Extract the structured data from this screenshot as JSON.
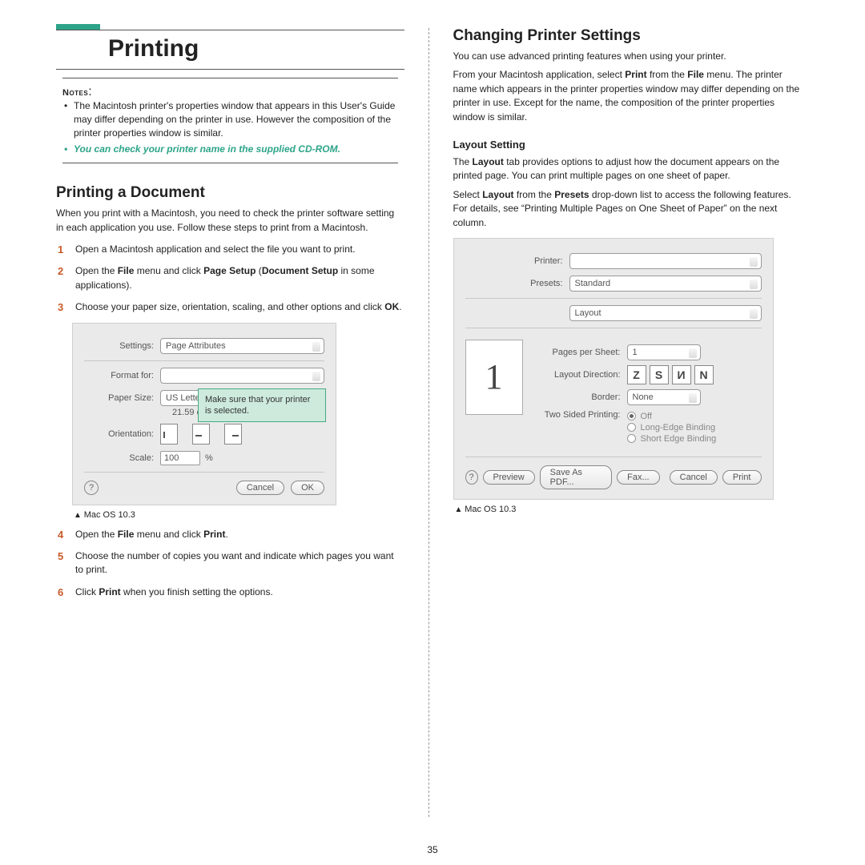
{
  "page_number": "35",
  "left": {
    "title": "Printing",
    "notes_label": "Notes",
    "note1": "The Macintosh printer's properties window that appears in this User's Guide may differ depending on the printer in use. However the composition of the printer properties window is similar.",
    "note2": "You can check your printer name in the supplied CD-ROM.",
    "sect": "Printing a Document",
    "p1": "When you print with a Macintosh, you need to check the printer software setting in each application you use. Follow these steps to print from a Macintosh.",
    "step1": "Open a Macintosh application and select the file you want to print.",
    "step2_pre": "Open the ",
    "step2_b1": "File",
    "step2_mid": " menu and click ",
    "step2_b2": "Page Setup",
    "step2_paren_open": " (",
    "step2_b3": "Document Setup",
    "step2_end": " in some applications).",
    "step3_pre": "Choose your paper size, orientation, scaling, and other options and click ",
    "step3_b": "OK",
    "step3_dot": ".",
    "shot_caption": "Mac OS 10.3",
    "step4_pre": "Open the ",
    "step4_b1": "File",
    "step4_mid": " menu and click ",
    "step4_b2": "Print",
    "step4_dot": ".",
    "step5": "Choose the number of copies you want and indicate which pages you want to print.",
    "step6_pre": "Click ",
    "step6_b": "Print",
    "step6_post": " when you finish setting the options.",
    "shot1": {
      "settings_label": "Settings:",
      "settings_value": "Page Attributes",
      "format_label": "Format for:",
      "paper_label": "Paper Size:",
      "paper_value": "US Letter",
      "paper_dim": "21.59 cm",
      "orientation_label": "Orientation:",
      "scale_label": "Scale:",
      "scale_value": "100",
      "percent": "%",
      "cancel": "Cancel",
      "ok": "OK",
      "help": "?",
      "tooltip": "Make sure that your printer is selected."
    }
  },
  "right": {
    "sect": "Changing Printer Settings",
    "p1": "You can use advanced printing features when using your printer.",
    "p2_pre": "From your Macintosh application, select ",
    "p2_b1": "Print",
    "p2_mid": " from the ",
    "p2_b2": "File",
    "p2_post": " menu. The printer name which appears in the printer properties window may differ depending on the printer in use. Except for the name, the composition of the printer properties window is similar.",
    "sub": "Layout Setting",
    "p3_pre": "The ",
    "p3_b": "Layout",
    "p3_post": " tab provides options to adjust how the document appears on the printed page. You can print multiple pages on one sheet of paper.",
    "p4_pre": "Select ",
    "p4_b1": "Layout",
    "p4_mid": " from the ",
    "p4_b2": "Presets",
    "p4_post": " drop-down list to access the following features. For details, see “Printing Multiple Pages on One Sheet of Paper” on the next column.",
    "shot_caption": "Mac OS 10.3",
    "shot2": {
      "printer_label": "Printer:",
      "presets_label": "Presets:",
      "presets_value": "Standard",
      "panel_value": "Layout",
      "thumb": "1",
      "pps_label": "Pages per Sheet:",
      "pps_value": "1",
      "dir_label": "Layout Direction:",
      "dir_glyphs": [
        "Z",
        "S",
        "И",
        "N"
      ],
      "border_label": "Border:",
      "border_value": "None",
      "tsp_label": "Two Sided Printing:",
      "tsp_opt1": "Off",
      "tsp_opt2": "Long-Edge Binding",
      "tsp_opt3": "Short Edge Binding",
      "help": "?",
      "preview": "Preview",
      "save_pdf": "Save As PDF...",
      "fax": "Fax...",
      "cancel": "Cancel",
      "print": "Print"
    }
  }
}
